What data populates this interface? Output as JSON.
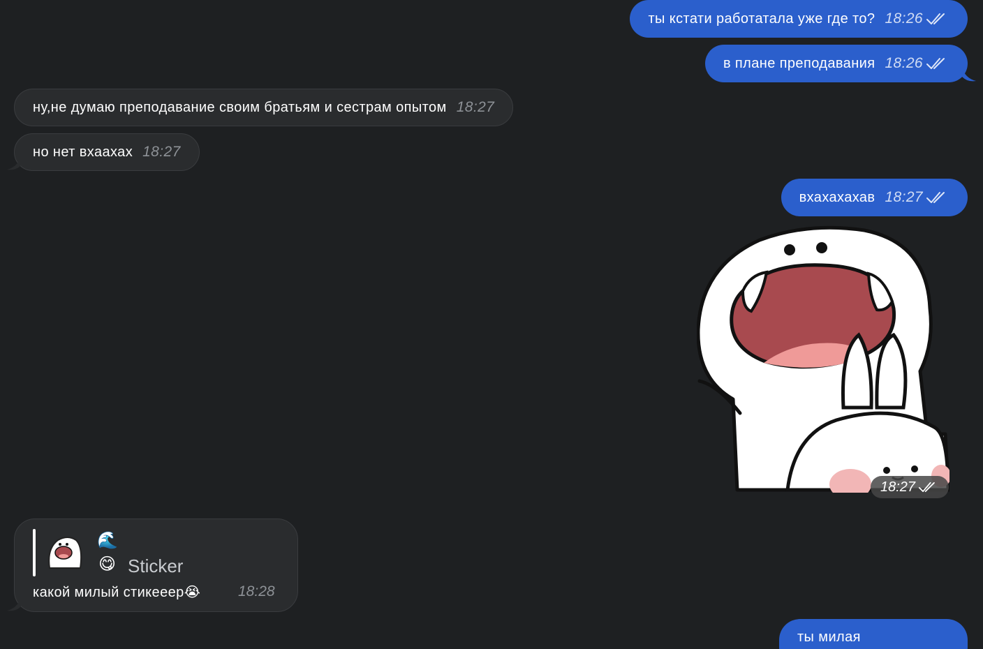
{
  "messages": [
    {
      "text": "ты кстати работатала уже где то?",
      "time": "18:26"
    },
    {
      "text": "в плане преподавания",
      "time": "18:26"
    },
    {
      "text": "ну,не думаю преподавание своим братьям и сестрам опытом",
      "time": "18:27"
    },
    {
      "text": "но нет вхаахах",
      "time": "18:27"
    },
    {
      "text": "вхахахахав",
      "time": "18:27"
    },
    {
      "sticker_time": "18:27"
    },
    {
      "reply": {
        "emoji_top": "🌊",
        "emoji": "😋",
        "kind": "Sticker"
      },
      "text": "какой милый стикееер😭",
      "time": "18:28"
    },
    {
      "text": "ты милая"
    }
  ],
  "colors": {
    "outgoing": "#2b5fcc",
    "incoming": "#2a2c2e",
    "background": "#1e2022"
  },
  "icons": {
    "read_receipt": "double-check-icon"
  }
}
